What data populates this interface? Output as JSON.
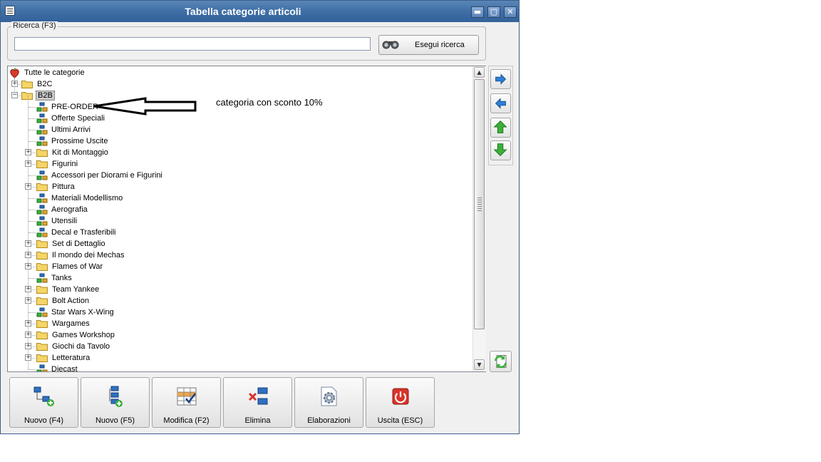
{
  "window": {
    "title": "Tabella categorie articoli",
    "minimize": "▬",
    "maximize": "▢",
    "close": "✕"
  },
  "search": {
    "legend": "Ricerca (F3)",
    "value": "",
    "button_label": "Esegui ricerca"
  },
  "tree": {
    "root": "Tutte le categorie",
    "groups": [
      {
        "label": "B2C"
      },
      {
        "label": "B2B",
        "selected": true
      }
    ],
    "items": [
      {
        "label": "PRE-ORDER",
        "kind": "node"
      },
      {
        "label": "Offerte Speciali",
        "kind": "node"
      },
      {
        "label": "Ultimi Arrivi",
        "kind": "node"
      },
      {
        "label": "Prossime Uscite",
        "kind": "node"
      },
      {
        "label": "Kit di Montaggio",
        "kind": "folder"
      },
      {
        "label": "Figurini",
        "kind": "folder"
      },
      {
        "label": "Accessori per Diorami e Figurini",
        "kind": "node"
      },
      {
        "label": "Pittura",
        "kind": "folder"
      },
      {
        "label": "Materiali Modellismo",
        "kind": "node"
      },
      {
        "label": "Aerografia",
        "kind": "node"
      },
      {
        "label": "Utensili",
        "kind": "node"
      },
      {
        "label": "Decal e Trasferibili",
        "kind": "node"
      },
      {
        "label": "Set di Dettaglio",
        "kind": "folder"
      },
      {
        "label": "Il mondo dei Mechas",
        "kind": "folder"
      },
      {
        "label": "Flames of War",
        "kind": "folder"
      },
      {
        "label": "Tanks",
        "kind": "node"
      },
      {
        "label": "Team Yankee",
        "kind": "folder"
      },
      {
        "label": "Bolt Action",
        "kind": "folder"
      },
      {
        "label": "Star Wars X-Wing",
        "kind": "node"
      },
      {
        "label": "Wargames",
        "kind": "folder"
      },
      {
        "label": "Games Workshop",
        "kind": "folder"
      },
      {
        "label": "Giochi da Tavolo",
        "kind": "folder"
      },
      {
        "label": "Letteratura",
        "kind": "folder"
      },
      {
        "label": "Diecast",
        "kind": "node"
      }
    ]
  },
  "annotation": "categoria con sconto 10%",
  "side_buttons": [
    "arrow-right-icon",
    "arrow-left-icon",
    "arrow-up-icon",
    "arrow-down-icon"
  ],
  "bottom_buttons": [
    {
      "label": "Nuovo (F4)",
      "icon": "new-node-icon"
    },
    {
      "label": "Nuovo (F5)",
      "icon": "new-child-icon"
    },
    {
      "label": "Modifica (F2)",
      "icon": "edit-table-icon"
    },
    {
      "label": "Elimina",
      "icon": "delete-node-icon"
    },
    {
      "label": "Elaborazioni",
      "icon": "process-gear-icon"
    },
    {
      "label": "Uscita (ESC)",
      "icon": "exit-power-icon"
    }
  ],
  "colors": {
    "titlebar": "#3f6ea5",
    "folder": "#f5d468",
    "arrow_blue": "#2f7fd6",
    "arrow_green": "#3ab03a",
    "exit_red": "#d9342b"
  }
}
